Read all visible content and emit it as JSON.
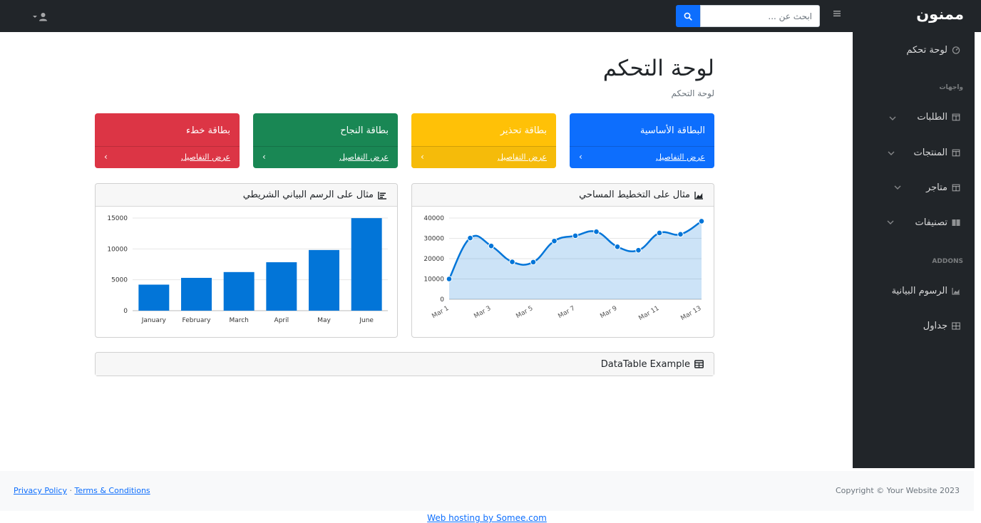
{
  "navbar": {
    "brand": "ممنون",
    "search_placeholder": "ابحث عن ...",
    "colors": {
      "bg": "#212529",
      "search_button": "#0d6efd"
    }
  },
  "sidebar": {
    "items": [
      {
        "label": "لوحة تحكم",
        "icon": "tachometer-icon"
      },
      {
        "label": "الطلبات",
        "icon": "columns-icon",
        "expandable": true
      },
      {
        "label": "المنتجات",
        "icon": "columns-icon",
        "expandable": true
      },
      {
        "label": "متاجر",
        "icon": "columns-icon",
        "expandable": true
      },
      {
        "label": "تصنيفات",
        "icon": "book-icon",
        "expandable": true
      },
      {
        "label": "الرسوم البيانية",
        "icon": "chart-area-icon"
      },
      {
        "label": "جداول",
        "icon": "table-icon"
      }
    ],
    "headings": {
      "interfaces": "واجهات",
      "addons": "ADDONS"
    }
  },
  "page": {
    "title": "لوحة التحكم",
    "breadcrumb": "لوحة التحكم"
  },
  "cards": [
    {
      "title": "البطاقة الأساسية",
      "link": "عرض التفاصيل",
      "color": "#0d6efd"
    },
    {
      "title": "بطاقة تحذير",
      "link": "عرض التفاصيل",
      "color": "#ffc107"
    },
    {
      "title": "بطاقة النجاح",
      "link": "عرض التفاصيل",
      "color": "#198754"
    },
    {
      "title": "بطاقة خطء",
      "link": "عرض التفاصيل",
      "color": "#dc3545"
    }
  ],
  "panels": {
    "area_title": "مثال على التخطيط المساحي",
    "bar_title": "مثال على الرسم البياني الشريطي",
    "datatable_title": "DataTable Example"
  },
  "chart_data": [
    {
      "type": "area",
      "x": [
        "Mar 1",
        "Mar 2",
        "Mar 3",
        "Mar 4",
        "Mar 5",
        "Mar 6",
        "Mar 7",
        "Mar 8",
        "Mar 9",
        "Mar 10",
        "Mar 11",
        "Mar 12",
        "Mar 13"
      ],
      "x_tick_labels": [
        "Mar 1",
        "Mar 3",
        "Mar 5",
        "Mar 7",
        "Mar 9",
        "Mar 11",
        "Mar 13"
      ],
      "values": [
        10000,
        30162,
        26263,
        18394,
        18287,
        28682,
        31274,
        33259,
        25849,
        24159,
        32651,
        31984,
        38451
      ],
      "ylim": [
        0,
        40000
      ],
      "y_ticks": [
        "0",
        "10000",
        "20000",
        "30000",
        "40000"
      ],
      "color": "#0275d8",
      "grid": true
    },
    {
      "type": "bar",
      "categories": [
        "January",
        "February",
        "March",
        "April",
        "May",
        "June"
      ],
      "values": [
        4215,
        5312,
        6251,
        7841,
        9821,
        14984
      ],
      "ylim": [
        0,
        15000
      ],
      "y_ticks": [
        "0",
        "5000",
        "10000",
        "15000"
      ],
      "color": "#0275d8",
      "grid": true
    }
  ],
  "footer": {
    "copyright": "Copyright © Your Website 2023",
    "privacy": "Privacy Policy",
    "separator": "·",
    "terms": "Terms & Conditions",
    "hosting": "Web hosting by Somee.com"
  }
}
